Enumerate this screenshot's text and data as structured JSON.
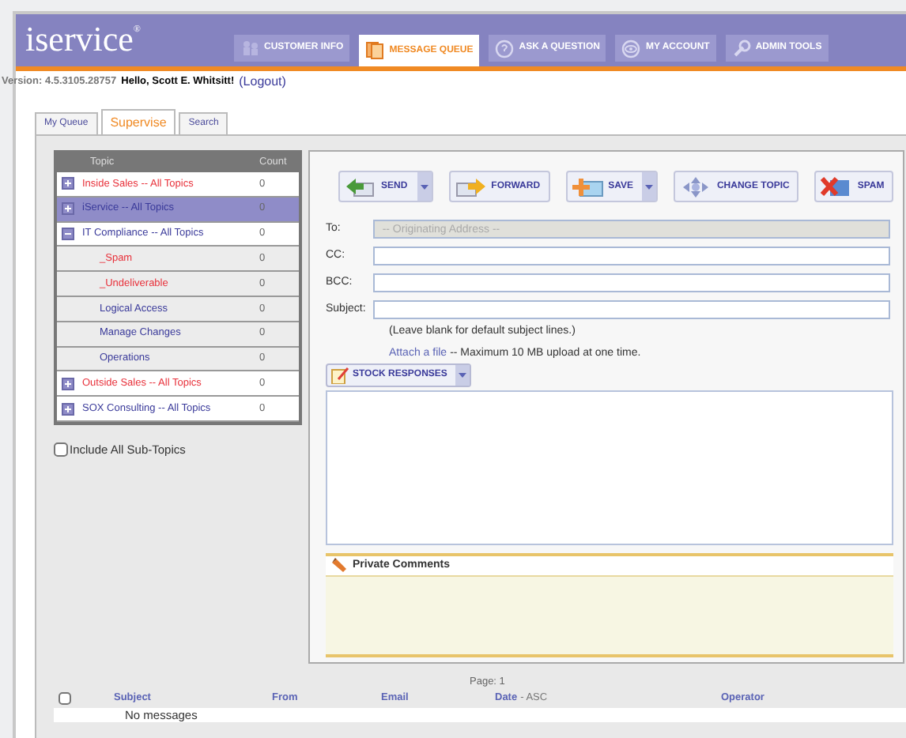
{
  "logo": {
    "text": "service",
    "initial": "i",
    "mark": "®"
  },
  "nav_tabs": [
    {
      "label": "CUSTOMER INFO",
      "selected": false
    },
    {
      "label": "MESSAGE QUEUE",
      "selected": true
    },
    {
      "label": "ASK A QUESTION",
      "selected": false
    },
    {
      "label": "MY ACCOUNT",
      "selected": false
    },
    {
      "label": "ADMIN TOOLS",
      "selected": false
    }
  ],
  "version": "Version: 4.5.3105.28757",
  "greeting": "Hello, Scott E. Whitsitt!",
  "logout": "(Logout)",
  "sub_tabs": [
    {
      "label": "My Queue",
      "selected": false
    },
    {
      "label": "Supervise",
      "selected": true
    },
    {
      "label": "Search",
      "selected": false
    }
  ],
  "topics": {
    "columns": [
      "Topic",
      "Count"
    ],
    "rows": [
      {
        "label": "Inside Sales -- All Topics",
        "count": "0",
        "color": "#e8303a",
        "selected": false,
        "expanded": false
      },
      {
        "label": "iService -- All Topics",
        "count": "0",
        "color": "#3a3a9a",
        "selected": true,
        "expanded": false
      },
      {
        "label": "IT Compliance -- All Topics",
        "count": "0",
        "color": "#3a3a9a",
        "selected": false,
        "expanded": true,
        "children": [
          {
            "label": "_Spam",
            "count": "0",
            "color": "#e8303a",
            "selected": false
          },
          {
            "label": "_Undeliverable",
            "count": "0",
            "color": "#e8303a",
            "selected": false
          },
          {
            "label": "Logical Access",
            "count": "0",
            "color": "#3a3a9a",
            "selected": false
          },
          {
            "label": "Manage Changes",
            "count": "0",
            "color": "#3a3a9a",
            "selected": false
          },
          {
            "label": "Operations",
            "count": "0",
            "color": "#3a3a9a",
            "selected": false
          }
        ]
      },
      {
        "label": "Outside Sales -- All Topics",
        "count": "0",
        "color": "#e8303a",
        "selected": false,
        "expanded": false
      },
      {
        "label": "SOX Consulting -- All Topics",
        "count": "0",
        "color": "#3a3a9a",
        "selected": false,
        "expanded": false
      }
    ],
    "include_sub_topics": {
      "label": "Include All Sub-Topics",
      "checked": false
    }
  },
  "toolbar": [
    {
      "label": "SEND",
      "dropdown": true
    },
    {
      "label": "FORWARD",
      "dropdown": false
    },
    {
      "label": "SAVE",
      "dropdown": true
    },
    {
      "label": "CHANGE TOPIC",
      "dropdown": false
    },
    {
      "label": "SPAM",
      "dropdown": false
    }
  ],
  "fields": [
    {
      "label": "To:",
      "placeholder": "-- Originating Address --",
      "disabled": true
    },
    {
      "label": "CC:",
      "disabled": false
    },
    {
      "label": "BCC:",
      "disabled": false
    },
    {
      "label": "Subject:",
      "disabled": false
    }
  ],
  "subject_hint": "(Leave blank for default subject lines.)",
  "attach_link": "Attach a file",
  "attach_note": "-- Maximum 10 MB upload at one time.",
  "stock_responses": "STOCK RESPONSES",
  "private_comments": "Private Comments",
  "pager": "Page: 1",
  "messages": {
    "select_all_checked": false,
    "columns": [
      {
        "label": "Subject"
      },
      {
        "label": "From"
      },
      {
        "label": "Email"
      },
      {
        "label": "Date",
        "suffix": "- ASC"
      },
      {
        "label": "Operator"
      }
    ],
    "empty": "No messages"
  }
}
